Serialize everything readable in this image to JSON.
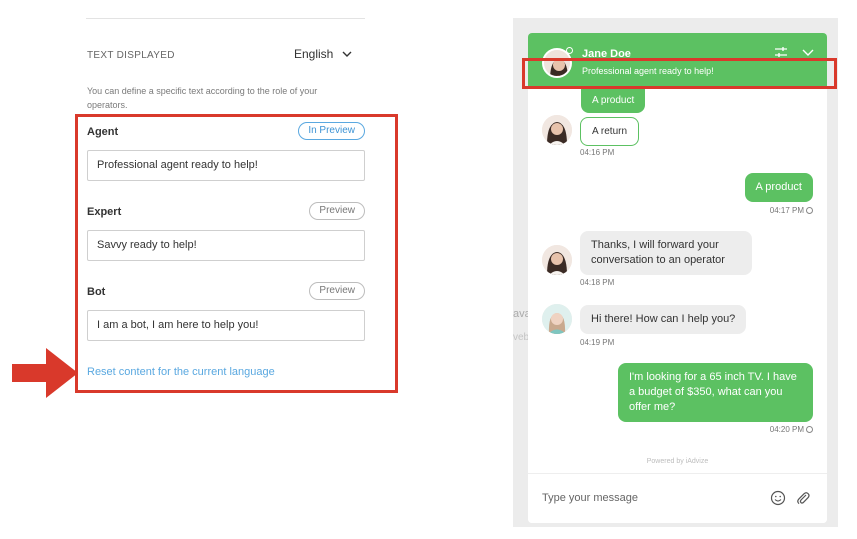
{
  "settings": {
    "section_title": "TEXT DISPLAYED",
    "language": "English",
    "description": "You can define a specific text according to the role of your operators.",
    "roles": [
      {
        "label": "Agent",
        "preview_label": "In Preview",
        "active": true,
        "text": "Professional agent ready to help!"
      },
      {
        "label": "Expert",
        "preview_label": "Preview",
        "active": false,
        "text": "Savvy ready to help!"
      },
      {
        "label": "Bot",
        "preview_label": "Preview",
        "active": false,
        "text": "I am a bot, I am here to help you!"
      }
    ],
    "reset_link": "Reset content for the current language"
  },
  "chat": {
    "agent_name": "Jane Doe",
    "agent_status": "Professional agent ready to help!",
    "messages": [
      {
        "text": "A product",
        "style": "green"
      },
      {
        "text": "A return",
        "style": "outline",
        "time": "04:16 PM"
      },
      {
        "text": "A product",
        "style": "green",
        "time": "04:17 PM"
      },
      {
        "text": "Thanks, I will forward your conversation to an operator",
        "style": "grey",
        "time": "04:18 PM"
      },
      {
        "text": "Hi there! How can I help you?",
        "style": "grey",
        "time": "04:19 PM"
      },
      {
        "text": "I'm looking for a 65 inch TV. I have a budget of $350, what can you offer me?",
        "style": "green",
        "time": "04:20 PM"
      }
    ],
    "powered_by": "Powered by iAdvize",
    "composer_placeholder": "Type your message",
    "bg_fragments": [
      "ava",
      "veb"
    ]
  },
  "colors": {
    "accent_green": "#5cc162",
    "highlight_red": "#d9392b",
    "link_blue": "#5aa8e0"
  }
}
